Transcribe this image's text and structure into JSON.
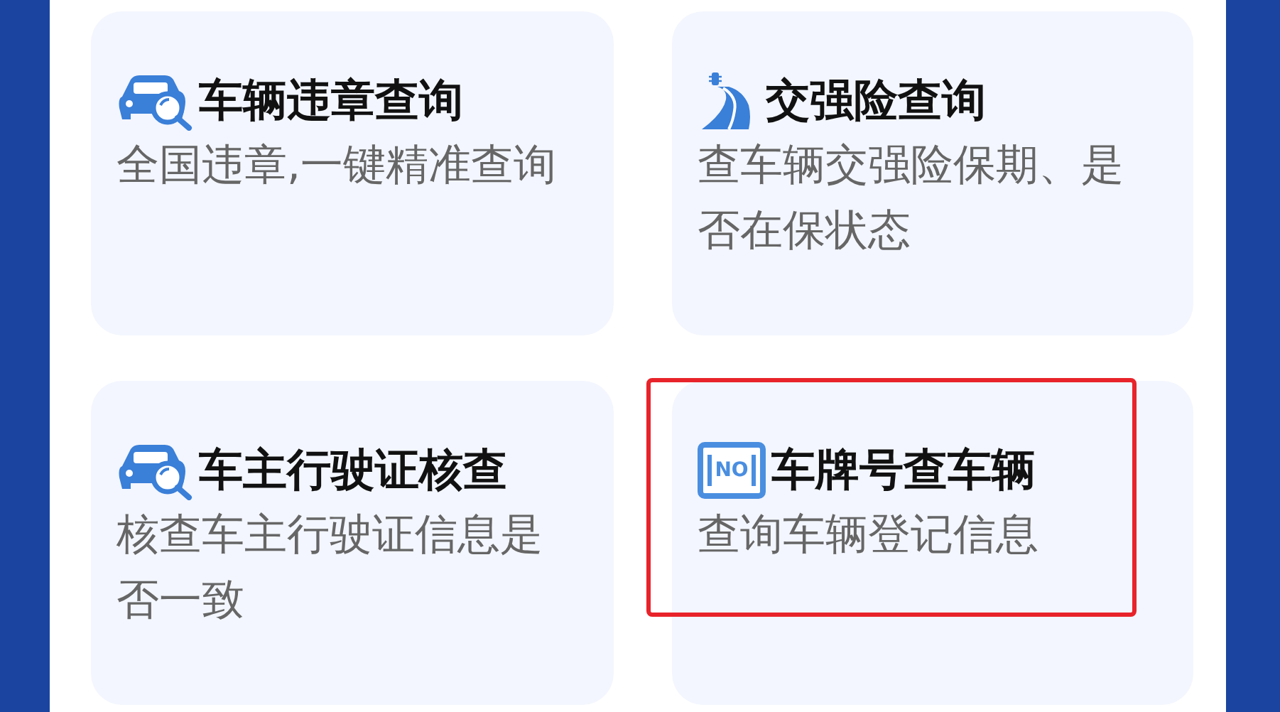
{
  "services": [
    {
      "kind": "car-search",
      "title": "车辆违章查询",
      "description": "全国违章,一键精准查询",
      "highlighted": false
    },
    {
      "kind": "road",
      "title": "交强险查询",
      "description": "查车辆交强险保期、是否在保状态",
      "highlighted": false
    },
    {
      "kind": "car-search",
      "title": "车主行驶证核查",
      "description": "核查车主行驶证信息是否一致",
      "highlighted": false
    },
    {
      "kind": "plate",
      "icon_text": "NO",
      "title": "车牌号查车辆",
      "description": "查询车辆登记信息",
      "highlighted": true
    }
  ]
}
